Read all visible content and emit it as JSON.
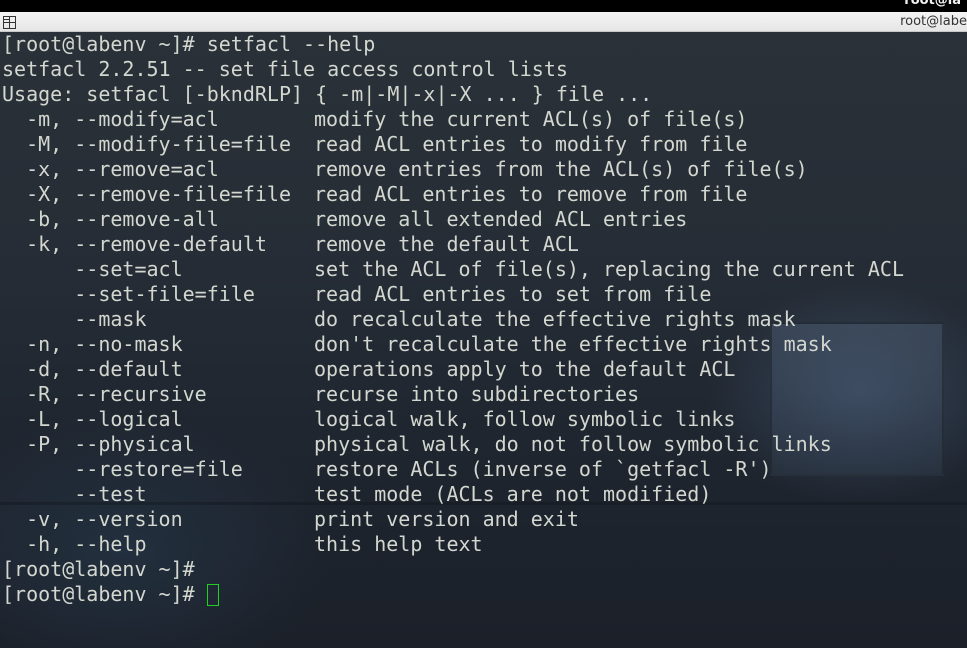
{
  "window": {
    "title": "root@labe",
    "title_clipped_top": "root@la",
    "icon": "terminal-grid-icon"
  },
  "terminal": {
    "prompt_command_line": "[root@labenv ~]# setfacl --help",
    "output_lines": [
      "setfacl 2.2.51 -- set file access control lists",
      "Usage: setfacl [-bkndRLP] { -m|-M|-x|-X ... } file ..."
    ],
    "options": [
      {
        "flag": "  -m, --modify=acl",
        "description": "modify the current ACL(s) of file(s)"
      },
      {
        "flag": "  -M, --modify-file=file",
        "description": "read ACL entries to modify from file"
      },
      {
        "flag": "  -x, --remove=acl",
        "description": "remove entries from the ACL(s) of file(s)"
      },
      {
        "flag": "  -X, --remove-file=file",
        "description": "read ACL entries to remove from file"
      },
      {
        "flag": "  -b, --remove-all",
        "description": "remove all extended ACL entries"
      },
      {
        "flag": "  -k, --remove-default",
        "description": "remove the default ACL"
      },
      {
        "flag": "      --set=acl",
        "description": "set the ACL of file(s), replacing the current ACL"
      },
      {
        "flag": "      --set-file=file",
        "description": "read ACL entries to set from file"
      },
      {
        "flag": "      --mask",
        "description": "do recalculate the effective rights mask"
      },
      {
        "flag": "  -n, --no-mask",
        "description": "don't recalculate the effective rights mask"
      },
      {
        "flag": "  -d, --default",
        "description": "operations apply to the default ACL"
      },
      {
        "flag": "  -R, --recursive",
        "description": "recurse into subdirectories"
      },
      {
        "flag": "  -L, --logical",
        "description": "logical walk, follow symbolic links"
      },
      {
        "flag": "  -P, --physical",
        "description": "physical walk, do not follow symbolic links"
      },
      {
        "flag": "      --restore=file",
        "description": "restore ACLs (inverse of `getfacl -R')"
      },
      {
        "flag": "      --test",
        "description": "test mode (ACLs are not modified)"
      },
      {
        "flag": "  -v, --version",
        "description": "print version and exit"
      },
      {
        "flag": "  -h, --help",
        "description": "this help text"
      }
    ],
    "trailing_prompts": [
      "[root@labenv ~]#",
      "[root@labenv ~]# "
    ],
    "cursor_color": "#21d021",
    "text_color": "#d3d7cf"
  }
}
